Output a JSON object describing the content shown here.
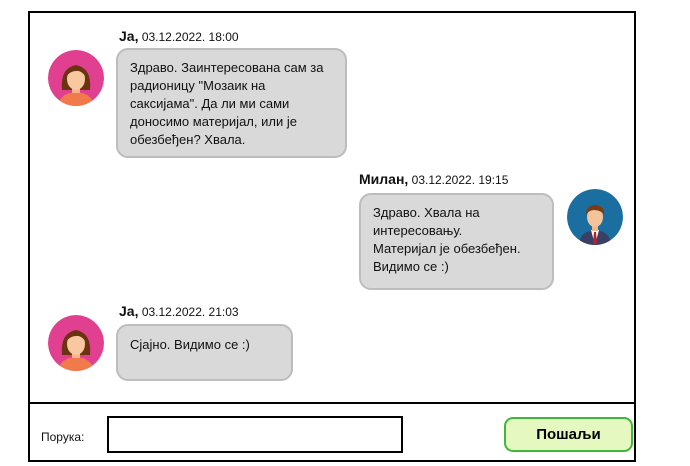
{
  "messages": [
    {
      "sender": "Ја,",
      "timestamp": "03.12.2022. 18:00",
      "lines": [
        "Здраво. Заинтересована сам за",
        "радионицу \"Мозаик на",
        "саксијама\". Да ли ми сами",
        "доносимо материјал, или је",
        "обезбеђен? Хвала."
      ],
      "avatar": "female-avatar-icon"
    },
    {
      "sender": "Милан,",
      "timestamp": "03.12.2022. 19:15",
      "lines": [
        "Здраво. Хвала на",
        "интересовању.",
        "Материјал је обезбеђен.",
        "Видимо се :)"
      ],
      "avatar": "male-avatar-icon"
    },
    {
      "sender": "Ја,",
      "timestamp": "03.12.2022. 21:03",
      "lines": [
        "Сјајно. Видимо се :)"
      ],
      "avatar": "female-avatar-icon"
    }
  ],
  "composer": {
    "label": "Порука:",
    "value": "",
    "send_label": "Пошаљи"
  },
  "colors": {
    "bubble": "#d9d9d9",
    "bubble_border": "#bdbdbd",
    "send_bg": "#e5f8c0",
    "send_border": "#41b63a",
    "female_avatar_bg": "#e0408f",
    "male_avatar_bg": "#1b6fa0"
  }
}
